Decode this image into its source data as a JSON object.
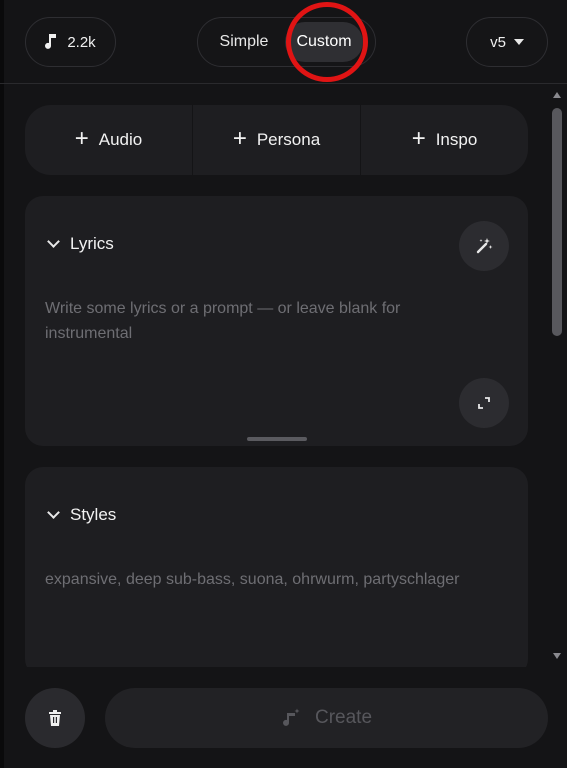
{
  "header": {
    "credits": "2.2k",
    "modes": [
      "Simple",
      "Custom"
    ],
    "active_mode": "Custom",
    "version": "v5"
  },
  "add_buttons": [
    "Audio",
    "Persona",
    "Inspo"
  ],
  "lyrics": {
    "title": "Lyrics",
    "placeholder": "Write some lyrics or a prompt — or leave blank for instrumental"
  },
  "styles": {
    "title": "Styles",
    "placeholder": "expansive, deep sub-bass, suona, ohrwurm, partyschlager"
  },
  "footer": {
    "create_label": "Create"
  },
  "colors": {
    "highlight_ring": "#e01414",
    "card_bg": "#1e1e21",
    "page_bg": "#141416"
  },
  "icons": [
    "music-note-icon",
    "caret-down-icon",
    "plus-icon",
    "chevron-down-icon",
    "magic-wand-icon",
    "expand-icon",
    "trash-icon",
    "music-sparkle-icon"
  ]
}
